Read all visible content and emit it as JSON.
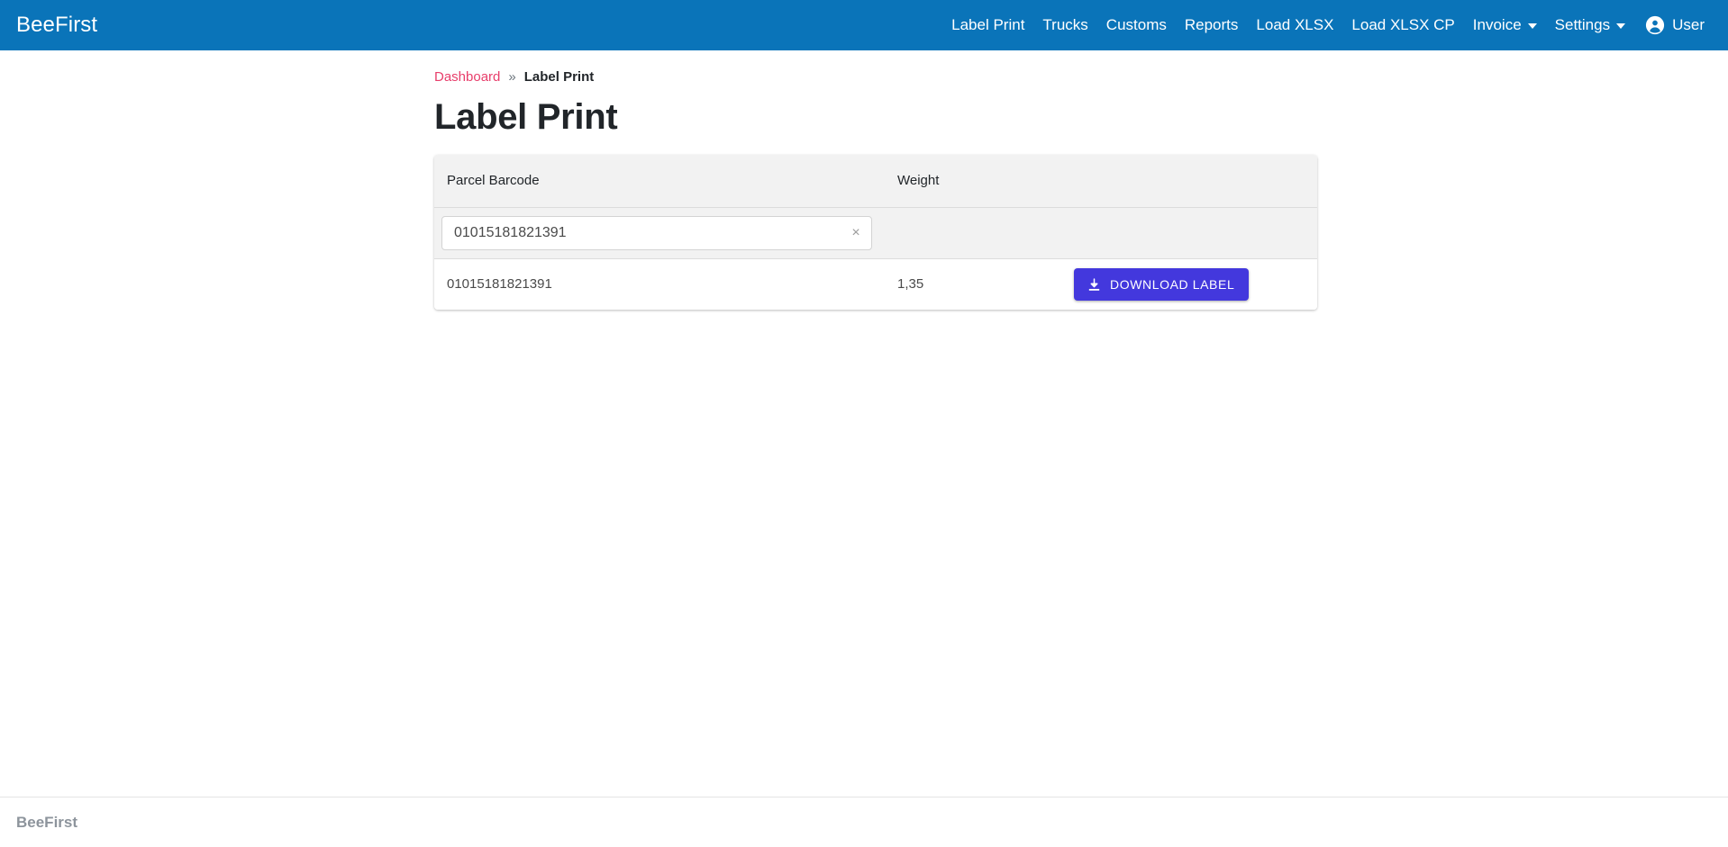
{
  "navbar": {
    "brand": "BeeFirst",
    "items": [
      {
        "label": "Label Print",
        "has_caret": false
      },
      {
        "label": "Trucks",
        "has_caret": false
      },
      {
        "label": "Customs",
        "has_caret": false
      },
      {
        "label": "Reports",
        "has_caret": false
      },
      {
        "label": "Load XLSX",
        "has_caret": false
      },
      {
        "label": "Load XLSX CP",
        "has_caret": false
      },
      {
        "label": "Invoice",
        "has_caret": true
      },
      {
        "label": "Settings",
        "has_caret": true
      }
    ],
    "user": {
      "label": "User",
      "icon": "account-circle-icon"
    },
    "background_color": "#0a74b9"
  },
  "breadcrumb": {
    "root": "Dashboard",
    "separator": "»",
    "current": "Label Print",
    "link_color": "#e83e6b"
  },
  "page": {
    "title": "Label Print"
  },
  "table": {
    "columns": [
      "Parcel Barcode",
      "Weight",
      ""
    ],
    "filter": {
      "value": "01015181821391",
      "placeholder": "",
      "clear_icon": "×"
    },
    "rows": [
      {
        "barcode": "01015181821391",
        "weight": "1,35",
        "action_label": "DOWNLOAD LABEL",
        "action_icon": "download-icon",
        "action_color": "#4338dd"
      }
    ]
  },
  "footer": {
    "text": "BeeFirst"
  }
}
